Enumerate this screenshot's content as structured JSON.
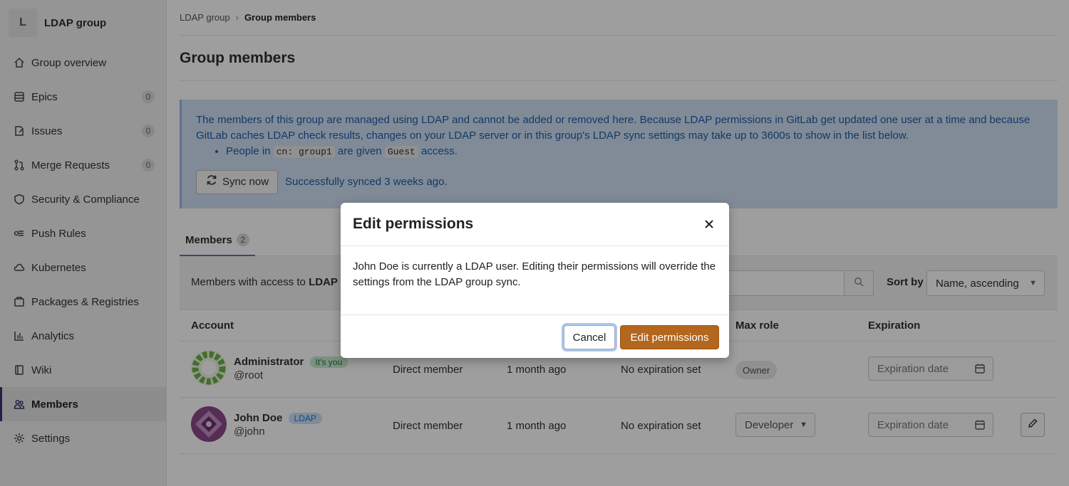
{
  "sidebar": {
    "group_initial": "L",
    "group_name": "LDAP group",
    "items": [
      {
        "label": "Group overview",
        "icon": "home-icon"
      },
      {
        "label": "Epics",
        "icon": "epic-icon",
        "count": "0"
      },
      {
        "label": "Issues",
        "icon": "issues-icon",
        "count": "0"
      },
      {
        "label": "Merge Requests",
        "icon": "merge-request-icon",
        "count": "0"
      },
      {
        "label": "Security & Compliance",
        "icon": "shield-icon"
      },
      {
        "label": "Push Rules",
        "icon": "push-rules-icon"
      },
      {
        "label": "Kubernetes",
        "icon": "cloud-icon"
      },
      {
        "label": "Packages & Registries",
        "icon": "package-icon"
      },
      {
        "label": "Analytics",
        "icon": "chart-icon"
      },
      {
        "label": "Wiki",
        "icon": "book-icon"
      },
      {
        "label": "Members",
        "icon": "users-icon",
        "active": true
      },
      {
        "label": "Settings",
        "icon": "gear-icon"
      }
    ]
  },
  "breadcrumb": {
    "parent": "LDAP group",
    "current": "Group members"
  },
  "page_title": "Group members",
  "alert": {
    "text": "The members of this group are managed using LDAP and cannot be added or removed here. Because LDAP permissions in GitLab get updated one user at a time and because GitLab caches LDAP check results, changes on your LDAP server or in this group's LDAP sync settings may take up to 3600s to show in the list below.",
    "bullet_prefix": "People in",
    "bullet_cn": "cn: group1",
    "bullet_middle": "are given",
    "bullet_role": "Guest",
    "bullet_suffix": "access.",
    "sync_button": "Sync now",
    "sync_status": "Successfully synced 3 weeks ago."
  },
  "tabs": {
    "members_label": "Members",
    "members_count": "2"
  },
  "filter": {
    "label": "Members with access to",
    "label_bold": "LDAP",
    "sort_label": "Sort by",
    "sort_value": "Name, ascending"
  },
  "table": {
    "headers": {
      "account": "Account",
      "max_role": "Max role",
      "expiration": "Expiration"
    },
    "rows": [
      {
        "name": "Administrator",
        "tag": "It's you",
        "handle": "@root",
        "source": "Direct member",
        "joined": "1 month ago",
        "expires": "No expiration set",
        "role": "Owner",
        "expiration_placeholder": "Expiration date"
      },
      {
        "name": "John Doe",
        "tag": "LDAP",
        "handle": "@john",
        "source": "Direct member",
        "joined": "1 month ago",
        "expires": "No expiration set",
        "role": "Developer",
        "expiration_placeholder": "Expiration date"
      }
    ]
  },
  "modal": {
    "title": "Edit permissions",
    "body": "John Doe is currently a LDAP user. Editing their permissions will override the settings from the LDAP group sync.",
    "cancel": "Cancel",
    "confirm": "Edit permissions"
  },
  "colors": {
    "confirm_button": "#b3661e",
    "alert_bg": "#cfe0f4",
    "active_nav_bar": "#333a6e"
  }
}
